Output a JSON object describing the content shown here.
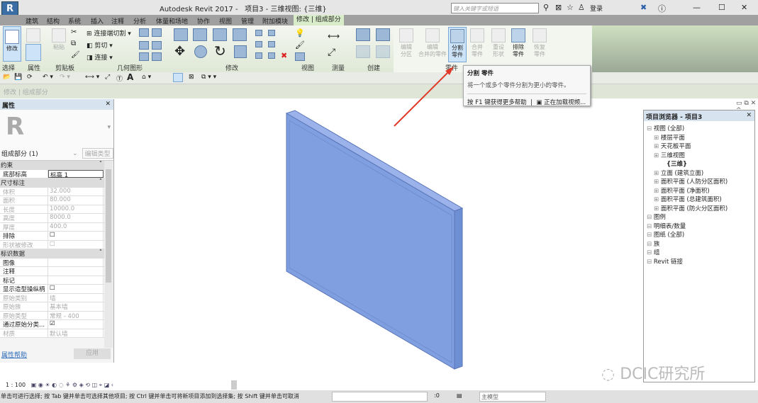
{
  "titlebar": {
    "app_title": "Autodesk Revit 2017 -",
    "doc_title": "项目3 - 三维视图: {三维}",
    "search_placeholder": "键入关键字或短语",
    "login": "登录",
    "logo": "R"
  },
  "tabs": [
    "建筑",
    "结构",
    "系统",
    "插入",
    "注释",
    "分析",
    "体量和场地",
    "协作",
    "视图",
    "管理",
    "附加模块",
    "修改 | 组成部分"
  ],
  "ribbon": {
    "modify": "修改",
    "paste": "粘贴",
    "join_cut": "连接端切割",
    "cut": "剪切",
    "join": "连接",
    "panels": {
      "select": "选择",
      "properties": "属性",
      "clipboard": "剪贴板",
      "geometry": "几何图形",
      "modify": "修改",
      "view": "视图",
      "measure": "测量",
      "create": "创建",
      "parts": "零件"
    },
    "parts_buttons": [
      {
        "label": "编辑\n分区",
        "enabled": false
      },
      {
        "label": "编辑\n合并的零件",
        "enabled": false
      },
      {
        "label": "分割\n零件",
        "enabled": true,
        "selected": true
      },
      {
        "label": "合并\n零件",
        "enabled": false
      },
      {
        "label": "重设\n形状",
        "enabled": false
      },
      {
        "label": "排除\n零件",
        "enabled": true
      },
      {
        "label": "恢复\n零件",
        "enabled": false
      }
    ]
  },
  "context_bar": "修改 | 组成部分",
  "tooltip": {
    "title": "分割 零件",
    "desc": "将一个或多个零件分割为更小的零件。",
    "help": "按 F1 键获得更多帮助",
    "video": "正在加载视频..."
  },
  "properties": {
    "title": "属性",
    "type_selector": "组成部分 (1)",
    "edit_type": "编辑类型",
    "groups": [
      {
        "name": "约束",
        "rows": [
          {
            "k": "底部标高",
            "v": "标高 1"
          }
        ]
      },
      {
        "name": "尺寸标注",
        "rows": [
          {
            "k": "体积",
            "v": "32.000",
            "dim": true
          },
          {
            "k": "面积",
            "v": "80.000",
            "dim": true
          },
          {
            "k": "长度",
            "v": "10000.0",
            "dim": true
          },
          {
            "k": "高度",
            "v": "8000.0",
            "dim": true
          },
          {
            "k": "厚度",
            "v": "400.0",
            "dim": true
          },
          {
            "k": "排除",
            "v": "☐"
          },
          {
            "k": "形状被修改",
            "v": "☐",
            "dim": true
          }
        ]
      },
      {
        "name": "标识数据",
        "rows": [
          {
            "k": "图像",
            "v": ""
          },
          {
            "k": "注释",
            "v": ""
          },
          {
            "k": "标记",
            "v": ""
          },
          {
            "k": "显示造型操纵柄",
            "v": "☐"
          },
          {
            "k": "原始类别",
            "v": "墙",
            "dim": true
          },
          {
            "k": "原始族",
            "v": "基本墙",
            "dim": true
          },
          {
            "k": "原始类型",
            "v": "常规 - 400",
            "dim": true
          },
          {
            "k": "通过原始分类...",
            "v": "☑"
          },
          {
            "k": "材质",
            "v": "默认墙",
            "dim": true
          }
        ]
      }
    ],
    "help_link": "属性帮助",
    "apply": "应用"
  },
  "browser": {
    "title": "项目浏览器 - 项目3",
    "items": [
      {
        "t": "视图 (全部)",
        "l": 0
      },
      {
        "t": "楼层平面",
        "l": 1
      },
      {
        "t": "天花板平面",
        "l": 1
      },
      {
        "t": "三维视图",
        "l": 1
      },
      {
        "t": "{三维}",
        "l": 2
      },
      {
        "t": "立面 (建筑立面)",
        "l": 1
      },
      {
        "t": "面积平面 (人防分区面积)",
        "l": 1
      },
      {
        "t": "面积平面 (净面积)",
        "l": 1
      },
      {
        "t": "面积平面 (总建筑面积)",
        "l": 1
      },
      {
        "t": "面积平面 (防火分区面积)",
        "l": 1
      },
      {
        "t": "图例",
        "l": 0
      },
      {
        "t": "明细表/数量",
        "l": 0
      },
      {
        "t": "图纸 (全部)",
        "l": 0
      },
      {
        "t": "族",
        "l": 0
      },
      {
        "t": "组",
        "l": 0
      },
      {
        "t": "Revit 链接",
        "l": 0
      }
    ]
  },
  "viewbar": {
    "scale": "1 : 100"
  },
  "status": {
    "text": "单击可进行选择; 按 Tab 键并单击可选择其他项目; 按 Ctrl 键并单击可将新项目添加到选择集; 按 Shift 键并单击可取消",
    "count": ":0",
    "model": "主模型"
  },
  "watermark": "DCIC研究所",
  "colors": {
    "wall": "#7f9fe0",
    "arrow": "#e03a2a",
    "active_tab": "#d9ecc9"
  }
}
